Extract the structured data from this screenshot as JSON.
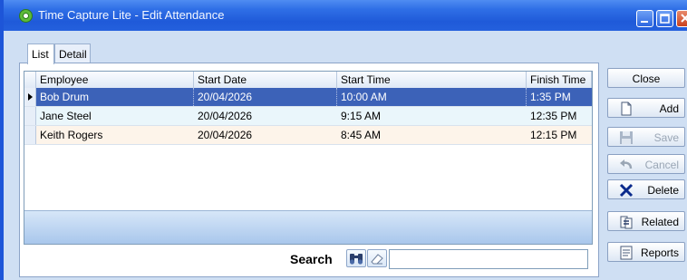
{
  "window": {
    "title": "Time Capture Lite - Edit Attendance",
    "controls": [
      "minimize",
      "maximize",
      "close"
    ]
  },
  "tabs": [
    {
      "label": "List",
      "active": true
    },
    {
      "label": "Detail",
      "active": false
    }
  ],
  "grid": {
    "columns": [
      "Employee",
      "Start Date",
      "Start Time",
      "Finish Time"
    ],
    "rows": [
      {
        "employee": "Bob Drum",
        "start_date": "20/04/2026",
        "start_time": "10:00 AM",
        "finish_time": "1:35 PM",
        "selected": true
      },
      {
        "employee": "Jane Steel",
        "start_date": "20/04/2026",
        "start_time": "9:15 AM",
        "finish_time": "12:35 PM",
        "selected": false
      },
      {
        "employee": "Keith Rogers",
        "start_date": "20/04/2026",
        "start_time": "8:45 AM",
        "finish_time": "12:15 PM",
        "selected": false
      }
    ]
  },
  "search": {
    "label": "Search",
    "value": "",
    "find_icon": "binoculars-icon",
    "clear_icon": "eraser-icon"
  },
  "side_buttons": {
    "close": {
      "label": "Close",
      "enabled": true
    },
    "add": {
      "label": "Add",
      "icon": "document-icon",
      "enabled": true
    },
    "save": {
      "label": "Save",
      "icon": "floppy-disk-icon",
      "enabled": false
    },
    "cancel": {
      "label": "Cancel",
      "icon": "undo-icon",
      "enabled": false
    },
    "delete": {
      "label": "Delete",
      "icon": "x-icon",
      "enabled": true
    },
    "related": {
      "label": "Related",
      "icon": "link-document-icon",
      "enabled": true
    },
    "reports": {
      "label": "Reports",
      "icon": "report-icon",
      "enabled": true
    }
  },
  "colors": {
    "titlebar": "#2460dd",
    "selected_row": "#3c62b8",
    "row_alt_blue": "#eaf6fb",
    "row_alt_peach": "#fdf4ea",
    "delete_icon": "#0a2a8c"
  }
}
